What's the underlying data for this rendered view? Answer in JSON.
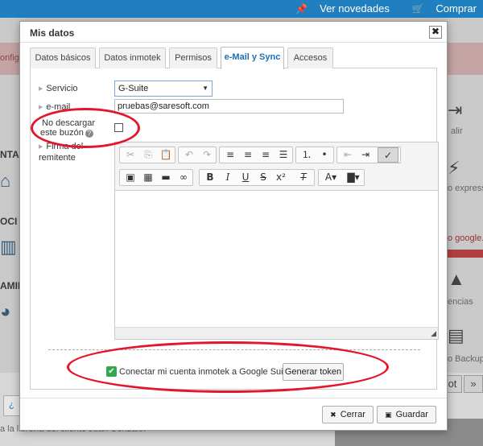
{
  "topbar": {
    "novedades_label": "Ver novedades",
    "comprar_label": "Comprar"
  },
  "background": {
    "left_fragments": [
      "onfig",
      "NTA",
      "OCI",
      "AMIE"
    ],
    "right_fragments": [
      "alir",
      "o express",
      "o google.",
      "encias",
      "o Backup"
    ],
    "pager_label": "ot",
    "pager_next": "»",
    "bottom_text": "a la librería del cliente Juan Gonzalo.",
    "bottom_tab_label": "¿"
  },
  "modal": {
    "title": "Mis datos",
    "close_label": "✖",
    "tabs": [
      {
        "label": "Datos básicos"
      },
      {
        "label": "Datos inmotek"
      },
      {
        "label": "Permisos"
      },
      {
        "label": "e-Mail y Sync"
      },
      {
        "label": "Accesos"
      }
    ],
    "fields": {
      "servicio_label": "Servicio",
      "servicio_value": "G-Suite",
      "email_label": "e-mail",
      "email_value": "pruebas@saresoft.com",
      "no_descargar_label_1": "No descargar",
      "no_descargar_label_2": "este buzón",
      "firma_label_1": "Firma del",
      "firma_label_2": "remitente"
    },
    "google": {
      "connect_label": "Conectar mi cuenta inmotek a Google Suite",
      "token_button": "Generar token"
    },
    "footer": {
      "cerrar_label": "Cerrar",
      "guardar_label": "Guardar"
    }
  },
  "colors": {
    "topbar": "#1f7fbf",
    "active_tab_text": "#1c6fb5",
    "annotation_red": "#e3162c",
    "check_green": "#2fa84f"
  }
}
